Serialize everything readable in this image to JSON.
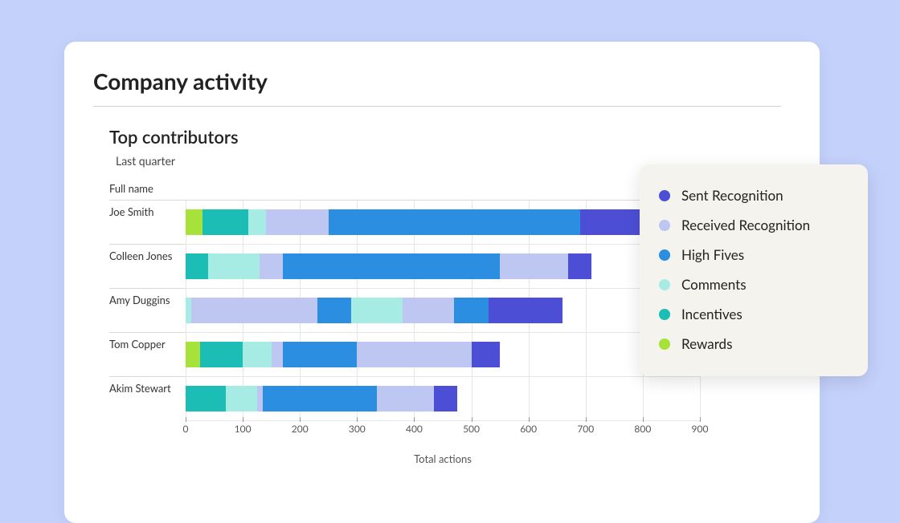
{
  "page_title": "Company activity",
  "chart_title": "Top contributors",
  "chart_subtitle": "Last quarter",
  "ylabel": "Full name",
  "xlabel": "Total actions",
  "legend": [
    {
      "label": "Sent Recognition",
      "color": "#4C4FD6"
    },
    {
      "label": "Received Recognition",
      "color": "#BEC6F2"
    },
    {
      "label": "High Fives",
      "color": "#2C8EE0"
    },
    {
      "label": "Comments",
      "color": "#A6EBE4"
    },
    {
      "label": "Incentives",
      "color": "#1CBDB5"
    },
    {
      "label": "Rewards",
      "color": "#A7E23A"
    }
  ],
  "chart_data": {
    "type": "bar",
    "orientation": "horizontal",
    "stacked": true,
    "title": "Top contributors",
    "subtitle": "Last quarter",
    "ylabel": "Full name",
    "xlabel": "Total actions",
    "xlim": [
      0,
      900
    ],
    "xticks": [
      0,
      100,
      200,
      300,
      400,
      500,
      600,
      700,
      800,
      900
    ],
    "categories": [
      "Joe Smith",
      "Colleen Jones",
      "Amy Duggins",
      "Tom Copper",
      "Akim Stewart"
    ],
    "series": [
      {
        "name": "Rewards",
        "color": "#A7E23A",
        "values": [
          30,
          0,
          0,
          25,
          0
        ]
      },
      {
        "name": "Incentives",
        "color": "#1CBDB5",
        "values": [
          80,
          40,
          0,
          75,
          70
        ]
      },
      {
        "name": "Comments",
        "color": "#A6EBE4",
        "values": [
          30,
          90,
          10,
          50,
          55
        ]
      },
      {
        "name": "Received Recognition",
        "color": "#BEC6F2",
        "values": [
          110,
          40,
          220,
          20,
          10
        ]
      },
      {
        "name": "High Fives",
        "color": "#2C8EE0",
        "values": [
          440,
          380,
          60,
          130,
          200
        ]
      },
      {
        "name": "Comments",
        "color": "#A6EBE4",
        "values": [
          0,
          0,
          90,
          0,
          0
        ]
      },
      {
        "name": "Received Recognition",
        "color": "#BEC6F2",
        "values": [
          0,
          120,
          90,
          200,
          100
        ]
      },
      {
        "name": "High Fives",
        "color": "#2C8EE0",
        "values": [
          0,
          0,
          60,
          0,
          0
        ]
      },
      {
        "name": "Sent Recognition",
        "color": "#4C4FD6",
        "values": [
          110,
          40,
          130,
          50,
          40
        ]
      }
    ]
  }
}
